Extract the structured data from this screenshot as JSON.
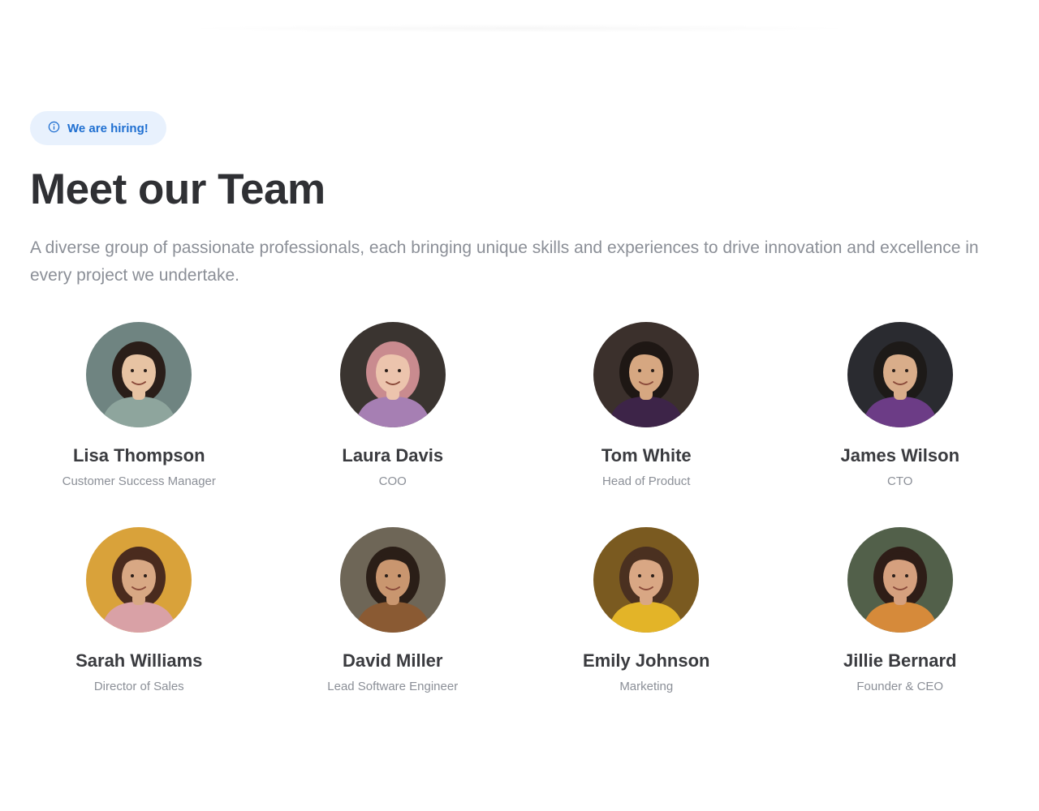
{
  "badge": {
    "label": "We are hiring!",
    "icon": "info-icon"
  },
  "title": "Meet our Team",
  "subtitle": "A diverse group of passionate professionals, each bringing unique skills and experiences to drive innovation and excellence in every project we undertake.",
  "members": [
    {
      "name": "Lisa Thompson",
      "role": "Customer Success Manager",
      "bg": "#6f8481",
      "skin": "#e7c3a3",
      "hair": "#2a1e19",
      "shirt": "#8ea59d"
    },
    {
      "name": "Laura Davis",
      "role": "COO",
      "bg": "#3a3430",
      "skin": "#ecc4ad",
      "hair": "#c98b8f",
      "shirt": "#a67fb3"
    },
    {
      "name": "Tom White",
      "role": "Head of Product",
      "bg": "#3b302c",
      "skin": "#d6a781",
      "hair": "#1e1714",
      "shirt": "#3d2448"
    },
    {
      "name": "James Wilson",
      "role": "CTO",
      "bg": "#2a2b30",
      "skin": "#d9ad8a",
      "hair": "#1d1a18",
      "shirt": "#6c3c86"
    },
    {
      "name": "Sarah Williams",
      "role": "Director of Sales",
      "bg": "#d9a23a",
      "skin": "#d8a884",
      "hair": "#4a2b1e",
      "shirt": "#d9a1a6"
    },
    {
      "name": "David Miller",
      "role": "Lead Software Engineer",
      "bg": "#6e6657",
      "skin": "#c9966f",
      "hair": "#2a1e17",
      "shirt": "#8a5a33"
    },
    {
      "name": "Emily Johnson",
      "role": "Marketing",
      "bg": "#7a5a20",
      "skin": "#d9a784",
      "hair": "#4a3020",
      "shirt": "#e3b428"
    },
    {
      "name": "Jillie Bernard",
      "role": "Founder & CEO",
      "bg": "#52604a",
      "skin": "#d5a07e",
      "hair": "#2e1d17",
      "shirt": "#d68a3a"
    }
  ]
}
